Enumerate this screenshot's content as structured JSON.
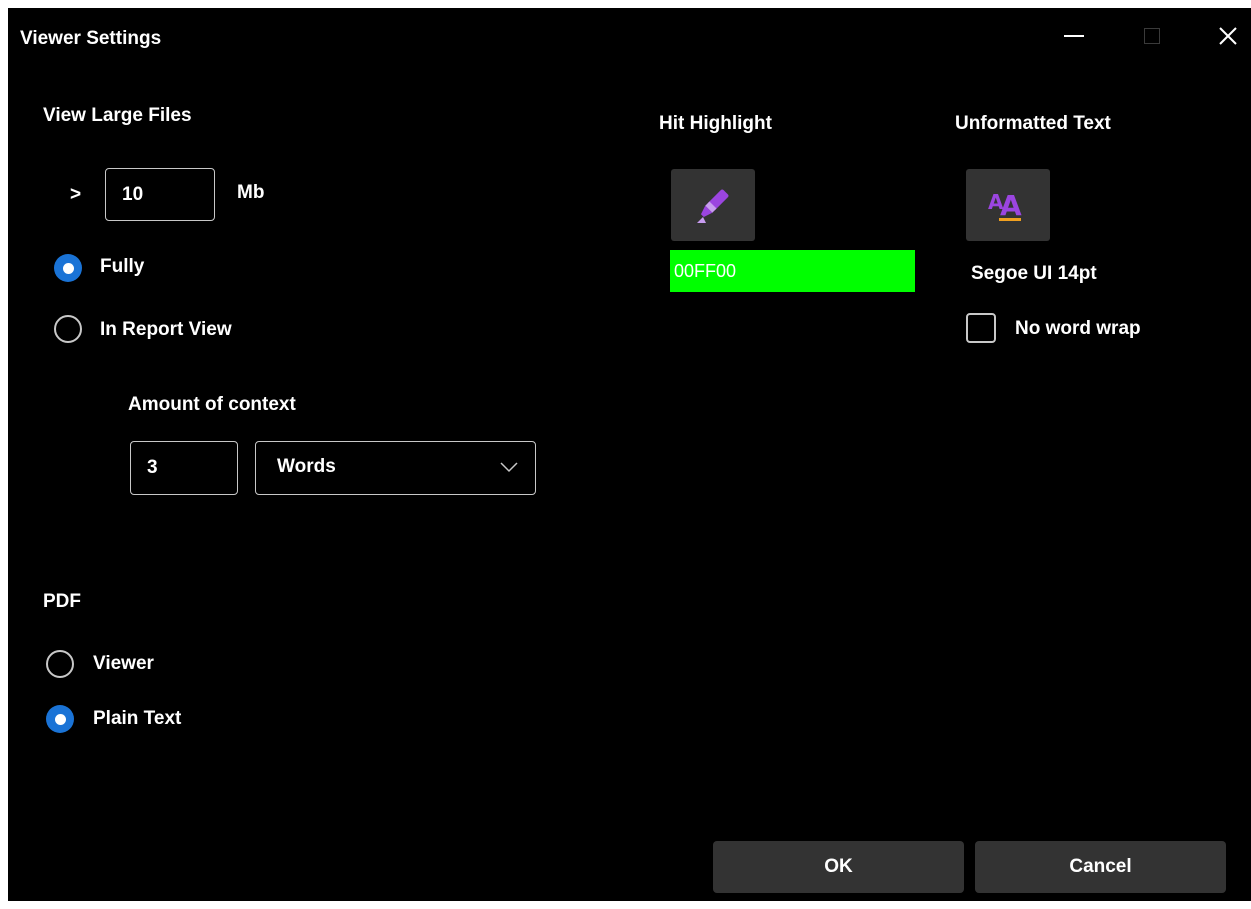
{
  "window": {
    "title": "Viewer Settings"
  },
  "large_files": {
    "heading": "View Large Files",
    "gt_symbol": ">",
    "size_value": "10",
    "size_unit": "Mb",
    "options": [
      {
        "label": "Fully",
        "checked": true
      },
      {
        "label": "In Report View",
        "checked": false
      }
    ],
    "context_label": "Amount of context",
    "context_value": "3",
    "context_unit_selected": "Words"
  },
  "pdf": {
    "heading": "PDF",
    "options": [
      {
        "label": "Viewer",
        "checked": false
      },
      {
        "label": "Plain Text",
        "checked": true
      }
    ]
  },
  "hit_highlight": {
    "heading": "Hit Highlight",
    "icon": "highlighter-icon",
    "color_value": "00FF00",
    "color_hex": "#00ff00"
  },
  "unformatted_text": {
    "heading": "Unformatted Text",
    "icon": "font-icon",
    "font_value": "Segoe UI 14pt",
    "no_wrap_label": "No word wrap",
    "no_wrap_checked": false
  },
  "buttons": {
    "ok_label": "OK",
    "cancel_label": "Cancel"
  },
  "colors": {
    "background": "#000000",
    "accent": "#1a73d6",
    "button": "#333333",
    "icon_purple": "#9b45e0",
    "icon_orange": "#f0a020"
  }
}
